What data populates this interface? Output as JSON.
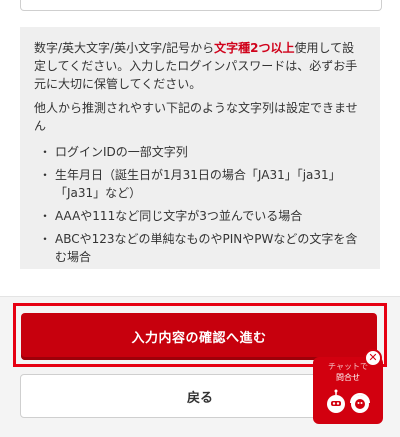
{
  "rules": {
    "para1_before": "数字/英大文字/英小文字/記号から",
    "para1_emphasis": "文字種2つ以上",
    "para1_after": "使用して設定してください。入力したログインパスワードは、必ずお手元に大切に保管してください。",
    "para2": "他人から推測されやすい下記のような文字列は設定できません",
    "bullet_char": "・",
    "items": [
      "ログインIDの一部文字列",
      "生年月日（誕生日が1月31日の場合「JA31」「ja31」「Ja31」など）",
      "AAAや111など同じ文字が3つ並んでいる場合",
      "ABCや123などの単純なものやPINやPWなどの文字を含む場合"
    ]
  },
  "buttons": {
    "confirm_label": "入力内容の確認へ進む",
    "back_label": "戻る"
  },
  "chat": {
    "small_text": "チャットで",
    "title": "問合せ",
    "close_glyph": "✕"
  },
  "colors": {
    "accent_red": "#c7000d",
    "highlight_frame": "#e60012",
    "info_background": "#efefef"
  }
}
